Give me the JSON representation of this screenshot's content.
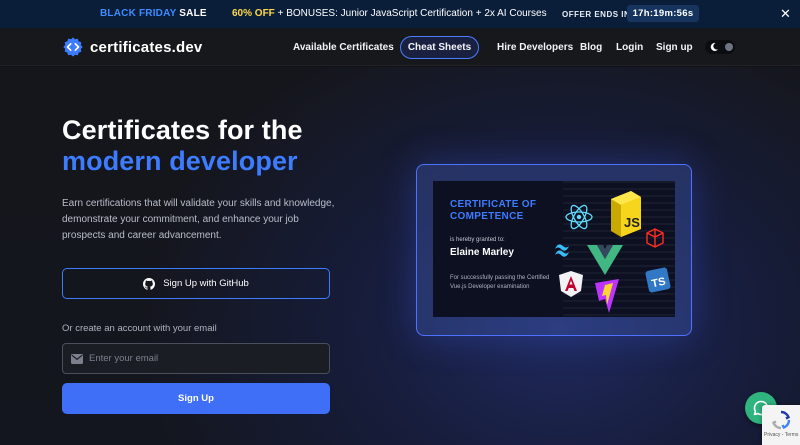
{
  "promo": {
    "black_friday_1": "BLACK FRIDAY",
    "black_friday_2": "SALE",
    "offer_pct": "60% OFF",
    "offer_rest": "+ BONUSES: Junior JavaScript Certification + 2x AI Courses",
    "ends_label": "OFFER ENDS IN",
    "timer": "17h:19m:56s",
    "close_icon": "close-icon"
  },
  "header": {
    "logo_text": "certificates.dev",
    "logo_icon": "gear-code-icon",
    "nav": {
      "available": "Available Certificates",
      "cheat": "Cheat Sheets",
      "hire": "Hire Developers",
      "blog": "Blog",
      "login": "Login",
      "signup": "Sign up"
    },
    "theme_toggle_icon": "moon-icon"
  },
  "hero": {
    "title_line1": "Certificates for the",
    "title_line2": "modern developer",
    "description": "Earn certifications that will validate your skills and knowledge, demonstrate your commitment, and enhance your job prospects and career advancement.",
    "github_button": "Sign Up with GitHub",
    "or_text": "Or create an account with your email",
    "email_placeholder": "Enter your email",
    "signup_button": "Sign Up"
  },
  "certificate": {
    "title_line1": "CERTIFICATE OF",
    "title_line2": "COMPETENCE",
    "granted": "is hereby granted to:",
    "name": "Elaine Marley",
    "success": "For successfully passing the Certified Vue.js Developer examination",
    "badges": [
      "react-icon",
      "js-icon",
      "laravel-icon",
      "tailwind-icon",
      "vue-icon",
      "angular-icon",
      "typescript-icon",
      "vite-icon"
    ],
    "js_label": "JS",
    "ts_label": "TS"
  },
  "widgets": {
    "chat_icon": "chat-icon",
    "recaptcha_text": "Privacy - Terms"
  },
  "colors": {
    "accent": "#3d7bff",
    "promo_bg": "#0a1e3a",
    "signup_bg": "#3f6ff7",
    "chat_bg": "#2fb37f"
  }
}
